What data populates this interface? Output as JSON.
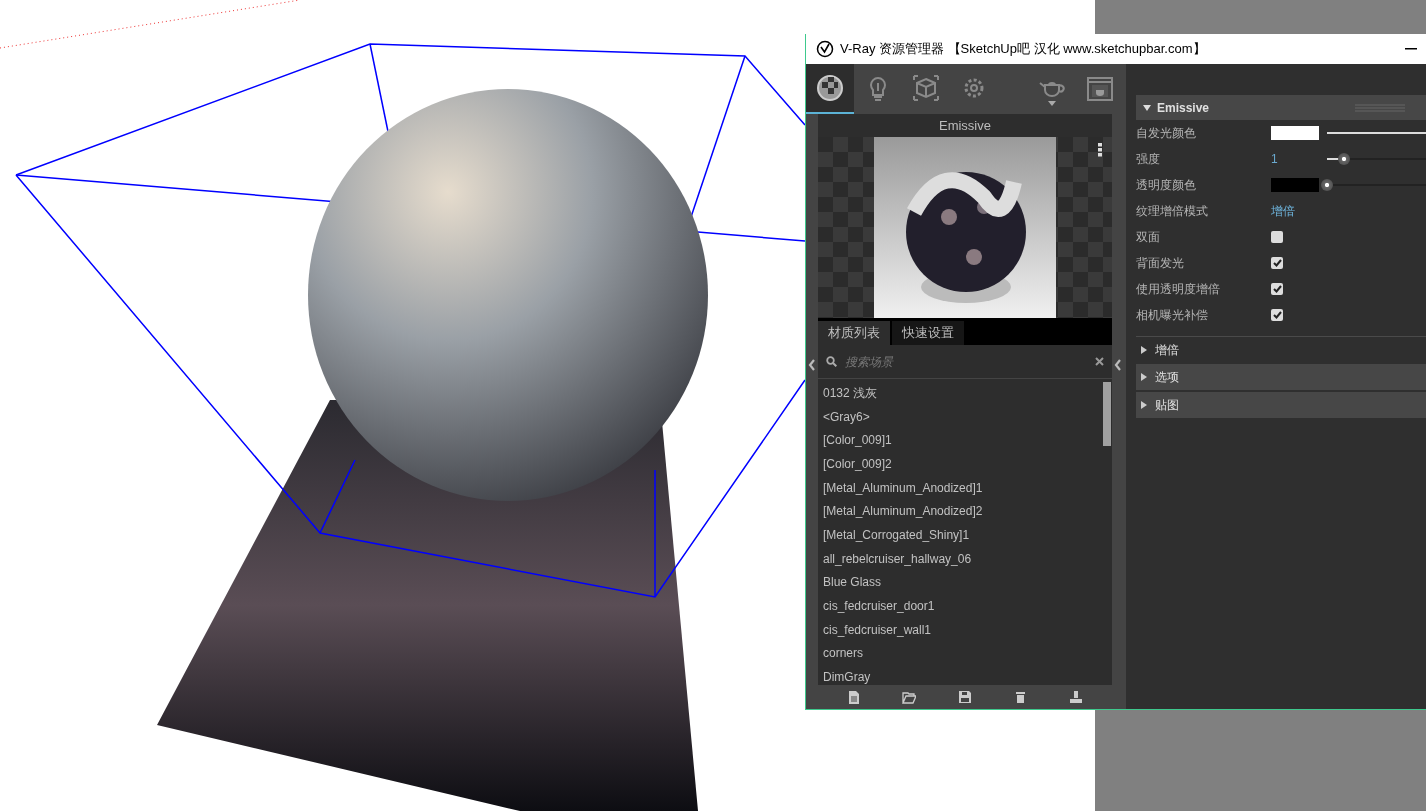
{
  "window": {
    "title": "V-Ray 资源管理器 【SketchUp吧 汉化 www.sketchupbar.com】"
  },
  "toolbar": {
    "tabs": [
      {
        "kind": "materials",
        "selected": true
      },
      {
        "kind": "lights",
        "selected": false
      },
      {
        "kind": "geometry",
        "selected": false
      },
      {
        "kind": "settings",
        "selected": false
      }
    ],
    "actions": [
      {
        "kind": "render"
      },
      {
        "kind": "frame-buffer"
      }
    ]
  },
  "preview": {
    "title": "Emissive"
  },
  "list_tabs": [
    {
      "label": "材质列表",
      "selected": true
    },
    {
      "label": "快速设置",
      "selected": false
    }
  ],
  "search": {
    "placeholder": "搜索场景"
  },
  "materials": [
    "0132 浅灰",
    "<Gray6>",
    "[Color_009]1",
    "[Color_009]2",
    "[Metal_Aluminum_Anodized]1",
    "[Metal_Aluminum_Anodized]2",
    "[Metal_Corrogated_Shiny]1",
    "all_rebelcruiser_hallway_06",
    "Blue Glass",
    "cis_fedcruiser_door1",
    "cis_fedcruiser_wall1",
    "corners",
    "DimGray"
  ],
  "bottom_tools": [
    {
      "kind": "new"
    },
    {
      "kind": "open"
    },
    {
      "kind": "save"
    },
    {
      "kind": "delete"
    },
    {
      "kind": "purge"
    }
  ],
  "properties": {
    "section": {
      "title": "Emissive",
      "expanded": true
    },
    "rows": [
      {
        "kind": "color",
        "label": "自发光颜色",
        "color": "#ffffff",
        "level": 1
      },
      {
        "kind": "number",
        "label": "强度",
        "value": "1",
        "level": 0.17
      },
      {
        "kind": "color",
        "label": "透明度颜色",
        "color": "#000000",
        "level": 0
      },
      {
        "kind": "link",
        "label": "纹理增倍模式",
        "value": "增倍"
      },
      {
        "kind": "checkbox",
        "label": "双面",
        "checked": false
      },
      {
        "kind": "checkbox",
        "label": "背面发光",
        "checked": true
      },
      {
        "kind": "checkbox",
        "label": "使用透明度增倍",
        "checked": true
      },
      {
        "kind": "checkbox",
        "label": "相机曝光补偿",
        "checked": true
      }
    ],
    "subsections": [
      {
        "title": "增倍",
        "kind": "plain",
        "expanded": false
      },
      {
        "title": "选项",
        "kind": "header",
        "expanded": false
      },
      {
        "title": "贴图",
        "kind": "header",
        "expanded": false
      }
    ]
  }
}
